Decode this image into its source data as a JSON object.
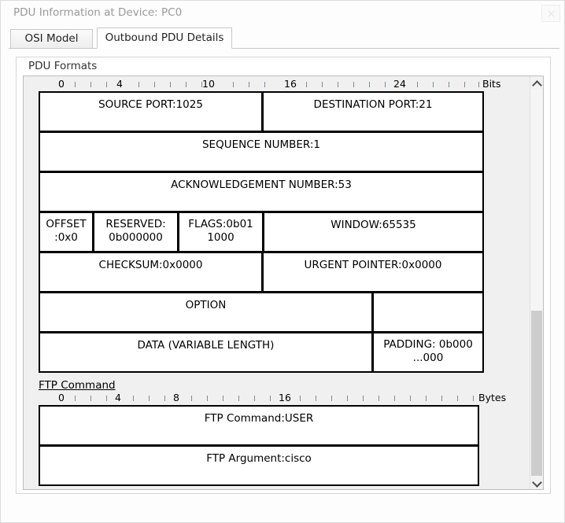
{
  "window": {
    "title": "PDU Information at Device: PC0",
    "close_icon": "close-icon"
  },
  "tabs": [
    {
      "label": "OSI Model",
      "active": false
    },
    {
      "label": "Outbound PDU Details",
      "active": true
    }
  ],
  "group": {
    "legend": "PDU Formats"
  },
  "scrollbar": {
    "up_icon": "chevron-up-icon",
    "down_icon": "chevron-down-icon"
  },
  "rulers": {
    "bits": {
      "unit": "Bits",
      "labels": [
        "0",
        "4",
        "10",
        "16",
        "24"
      ]
    },
    "bytes": {
      "unit": "Bytes",
      "labels": [
        "0",
        "4",
        "8",
        "16"
      ]
    }
  },
  "sections": [
    {
      "title": "FTP Command"
    }
  ],
  "tcp_header": {
    "source_port": "SOURCE PORT:1025",
    "destination_port": "DESTINATION PORT:21",
    "sequence_number": "SEQUENCE NUMBER:1",
    "acknowledgement_number": "ACKNOWLEDGEMENT NUMBER:53",
    "offset": "OFFSET\n:0x0",
    "offset_line1": "OFFSET",
    "offset_line2": ":0x0",
    "reserved_line1": "RESERVED:",
    "reserved_line2": "0b000000",
    "flags_line1": "FLAGS:0b01",
    "flags_line2": "1000",
    "window": "WINDOW:65535",
    "checksum": "CHECKSUM:0x0000",
    "urgent_pointer": "URGENT POINTER:0x0000",
    "option": "OPTION",
    "option_right": "",
    "data": "DATA (VARIABLE LENGTH)",
    "padding_line1": "PADDING: 0b000",
    "padding_line2": "...000"
  },
  "ftp": {
    "command": "FTP Command:USER",
    "argument": "FTP Argument:cisco"
  }
}
